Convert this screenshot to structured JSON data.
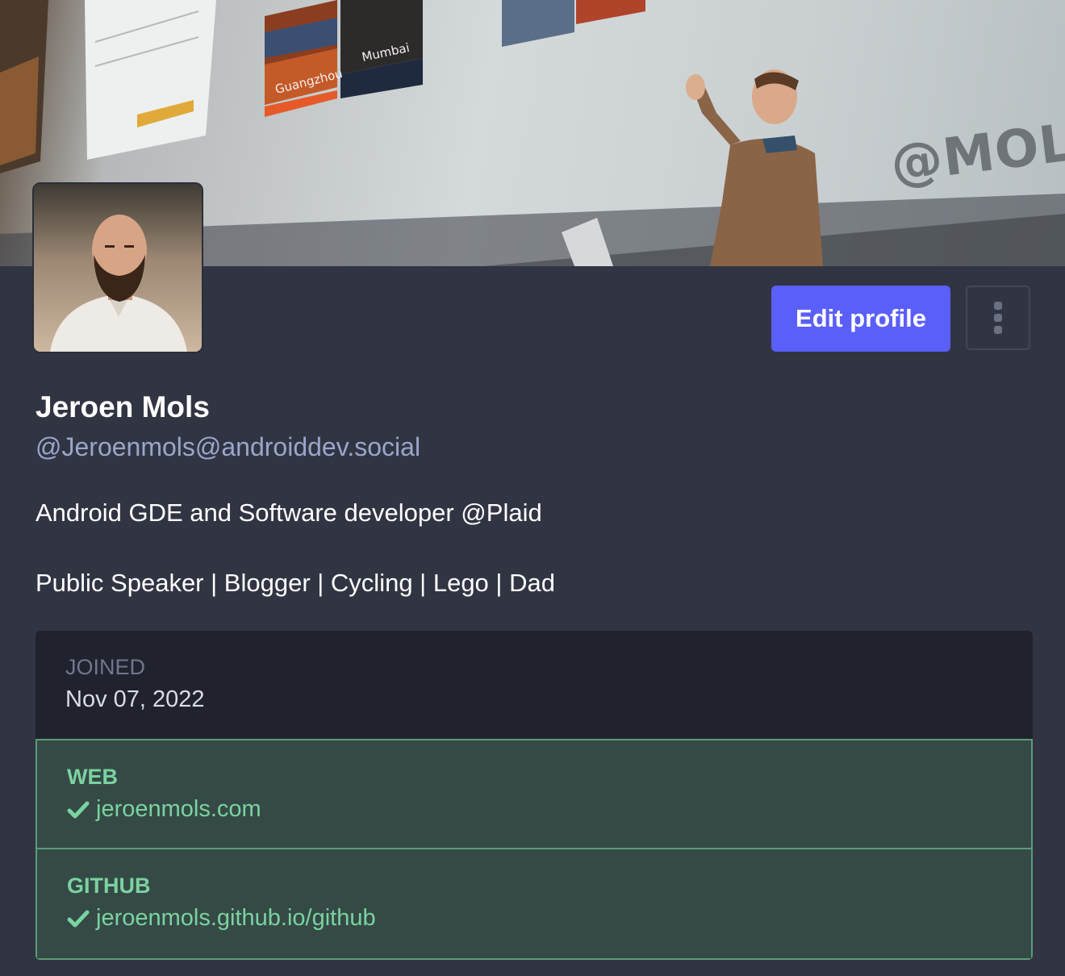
{
  "banner": {
    "screen_text": "@MOLS",
    "slide_city_1": "Guangzhou",
    "slide_city_2": "Mumbai"
  },
  "profile": {
    "display_name": "Jeroen Mols",
    "handle": "@Jeroenmols@androiddev.social",
    "bio_line_1": "Android GDE and Software developer @Plaid",
    "bio_line_2": "Public Speaker | Blogger | Cycling | Lego | Dad"
  },
  "actions": {
    "edit_label": "Edit profile",
    "more_icon": "vertical-ellipsis-icon"
  },
  "fields": {
    "joined": {
      "label": "JOINED",
      "value": "Nov 07, 2022"
    },
    "web": {
      "label": "WEB",
      "value": "jeroenmols.com",
      "verified": true
    },
    "github": {
      "label": "GITHUB",
      "value": "jeroenmols.github.io/github",
      "verified": true
    }
  },
  "colors": {
    "background": "#313543",
    "accent": "#5b5ff9",
    "verified": "#7ad3a0",
    "handle": "#9aa6c9"
  }
}
